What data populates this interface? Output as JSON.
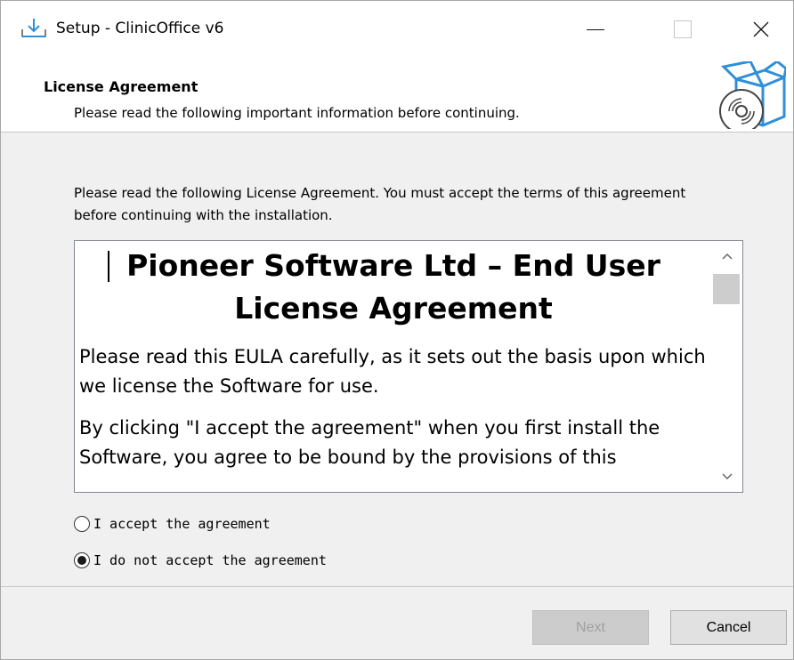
{
  "window": {
    "title": "Setup - ClinicOffice v6",
    "icons": {
      "app": "install-download-icon",
      "minimize": "minimize-icon",
      "maximize": "maximize-icon",
      "close": "close-icon"
    },
    "close_glyph": "✕"
  },
  "header": {
    "title": "License Agreement",
    "subtitle": "Please read the following important information before continuing.",
    "art": "software-box-disc-icon"
  },
  "intro": "Please read the following License Agreement. You must accept the terms of this agreement before continuing with the installation.",
  "license": {
    "heading": "Pioneer Software Ltd – End User License Agreement",
    "paragraphs": [
      "Please read this EULA carefully, as it sets out the basis upon which we license the Software for use.",
      "By clicking \"I accept the agreement\" when you first install the Software, you agree to be bound by the provisions of this"
    ],
    "scroll_up_glyph": "︿",
    "scroll_down_glyph": "﹀"
  },
  "options": [
    {
      "label": "I accept the agreement",
      "selected": false
    },
    {
      "label": "I do not accept the agreement",
      "selected": true
    }
  ],
  "buttons": {
    "next": "Next",
    "next_enabled": false,
    "cancel": "Cancel"
  },
  "colors": {
    "accent_blue": "#2f8fd8",
    "window_bg": "#f0f0f0",
    "disabled_text": "#a0a0a0"
  }
}
